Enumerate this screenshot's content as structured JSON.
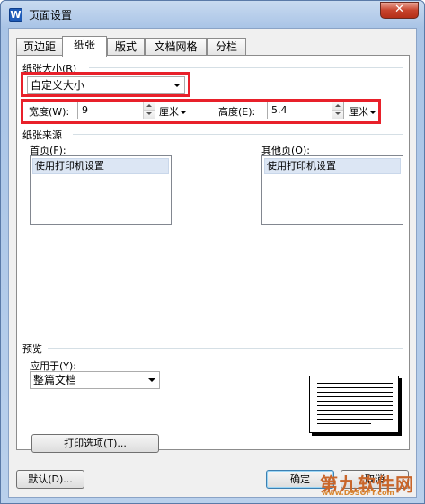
{
  "window": {
    "title": "页面设置",
    "app_icon": "W",
    "close_glyph": "✕"
  },
  "tabs": [
    {
      "label": "页边距"
    },
    {
      "label": "纸张"
    },
    {
      "label": "版式"
    },
    {
      "label": "文档网格"
    },
    {
      "label": "分栏"
    }
  ],
  "paper_size": {
    "group_label": "纸张大小(R)",
    "selected": "自定义大小",
    "width_label": "宽度(W):",
    "width_value": "9",
    "width_unit": "厘米",
    "height_label": "高度(E):",
    "height_value": "5.4",
    "height_unit": "厘米"
  },
  "paper_source": {
    "group_label": "纸张来源",
    "first_page_label": "首页(F):",
    "first_page_item": "使用打印机设置",
    "other_pages_label": "其他页(O):",
    "other_pages_item": "使用打印机设置"
  },
  "preview": {
    "group_label": "预览",
    "apply_to_label": "应用于(Y):",
    "apply_to_value": "整篇文档"
  },
  "buttons": {
    "print_options": "打印选项(T)...",
    "default": "默认(D)...",
    "ok": "确定",
    "cancel": "取消"
  },
  "watermark": {
    "text": "第九软件网",
    "sub": "www.D9SOFT.com"
  },
  "colors": {
    "highlight_box": "#e8202a",
    "selected_item_bg": "#dce6f4"
  },
  "icons": {
    "dropdown": "chevron-down-icon",
    "spin_up": "spin-up-icon",
    "spin_down": "spin-down-icon"
  }
}
